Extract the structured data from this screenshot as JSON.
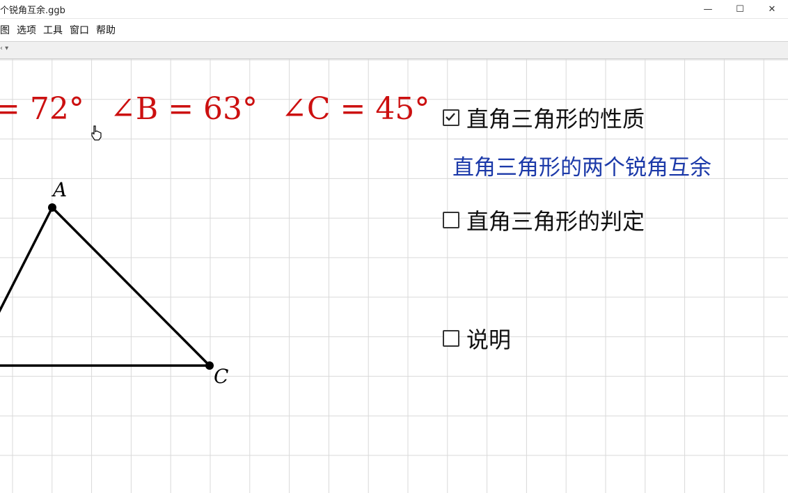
{
  "window": {
    "title": "个锐角互余.ggb",
    "minimize": "—",
    "maximize": "☐",
    "close": "✕"
  },
  "menu": {
    "items": [
      "图",
      "选项",
      "工具",
      "窗口",
      "帮助"
    ]
  },
  "toolbar": {
    "toggle": "‹ ▾"
  },
  "angles": {
    "a": "= 72°",
    "b": "∠B = 63°",
    "c": "∠C = 45°"
  },
  "points": {
    "a": "A",
    "c": "C"
  },
  "checkboxes": [
    {
      "label": "直角三角形的性质",
      "checked": true
    },
    {
      "label": "直角三角形的判定",
      "checked": false
    },
    {
      "label": "说明",
      "checked": false
    }
  ],
  "property_text": "直角三角形的两个锐角互余",
  "colors": {
    "angle_text": "#cc1010",
    "blue_text": "#1c3aa9",
    "grid": "#d9d9d9"
  }
}
